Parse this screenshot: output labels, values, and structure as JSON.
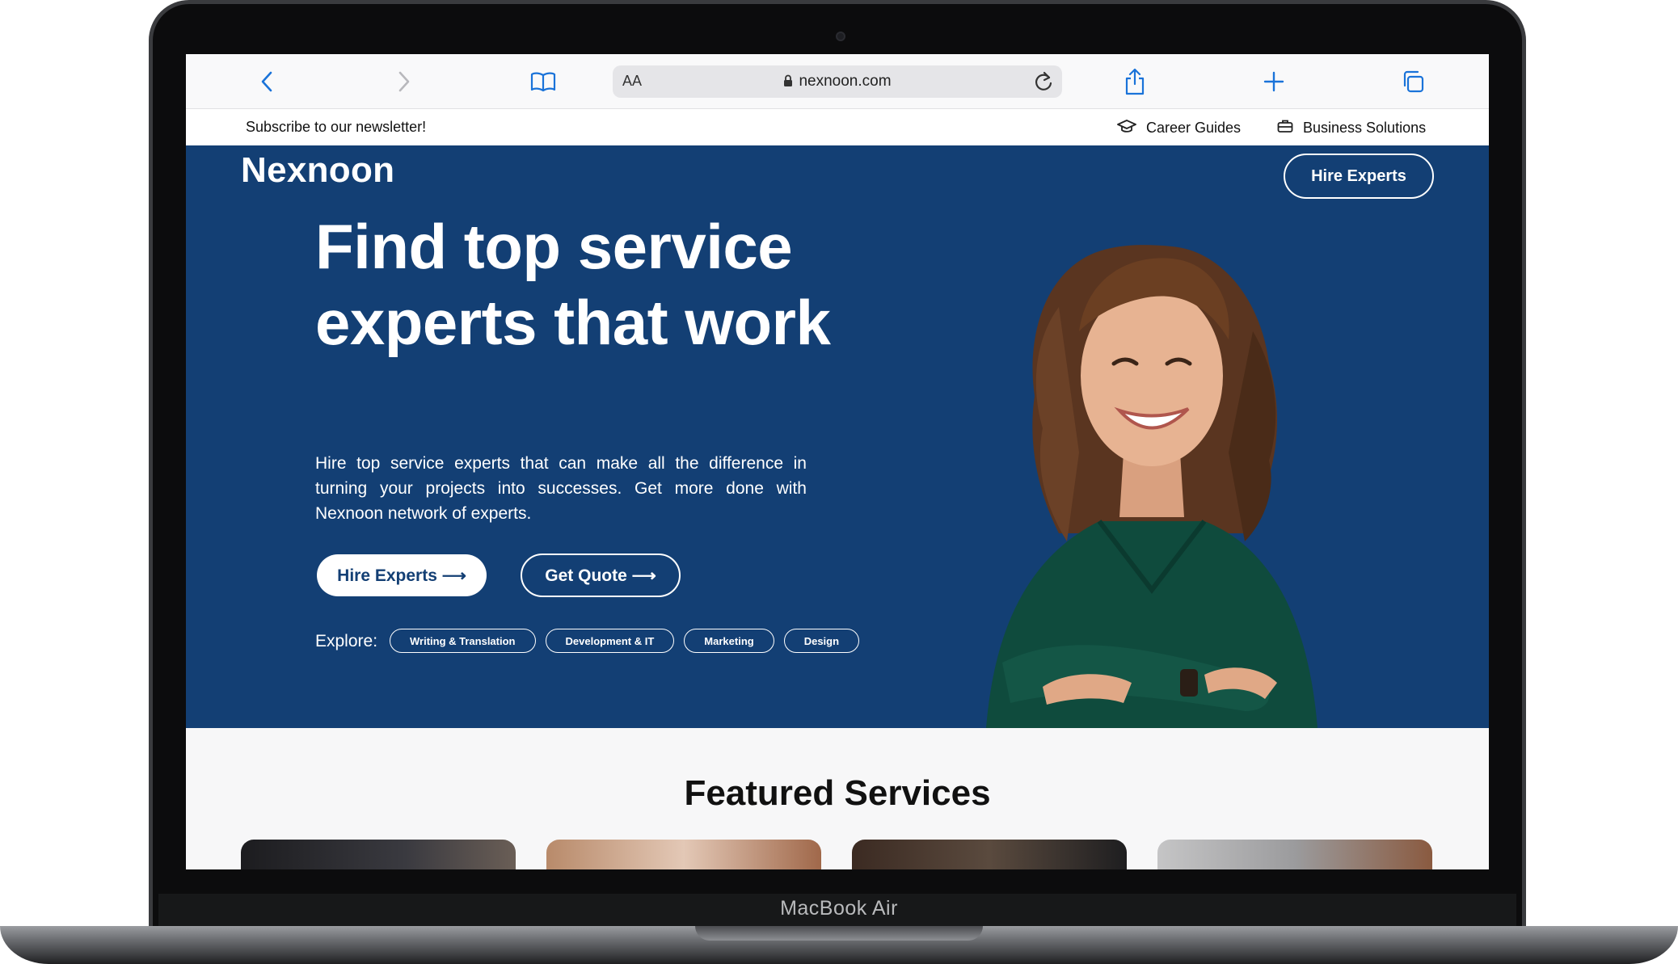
{
  "device": {
    "label": "MacBook Air"
  },
  "browser": {
    "reader_label": "AA",
    "url": "nexnoon.com",
    "icons": [
      "back-icon",
      "forward-icon",
      "bookmarks-icon",
      "lock-icon",
      "reload-icon",
      "share-icon",
      "new-tab-icon",
      "tabs-icon"
    ]
  },
  "topbar": {
    "newsletter": "Subscribe to our newsletter!",
    "links": [
      {
        "label": "Career Guides",
        "icon": "graduation-cap-icon"
      },
      {
        "label": "Business Solutions",
        "icon": "briefcase-icon"
      }
    ]
  },
  "header": {
    "logo": "Nexnoon",
    "cta": "Hire Experts"
  },
  "hero": {
    "headline_line1": "Find top service",
    "headline_line2": "experts that work",
    "subtext": "Hire top service experts that can make all the difference in turning your projects into successes. Get more done with Nexnoon network of experts.",
    "primary_button": "Hire Experts ⟶",
    "secondary_button": "Get Quote ⟶",
    "explore_label": "Explore:",
    "categories": [
      "Writing & Translation",
      "Development & IT",
      "Marketing",
      "Design"
    ]
  },
  "featured": {
    "title": "Featured Services"
  },
  "colors": {
    "brand_navy": "#133f74",
    "ios_blue": "#1a73d9",
    "white": "#ffffff"
  }
}
